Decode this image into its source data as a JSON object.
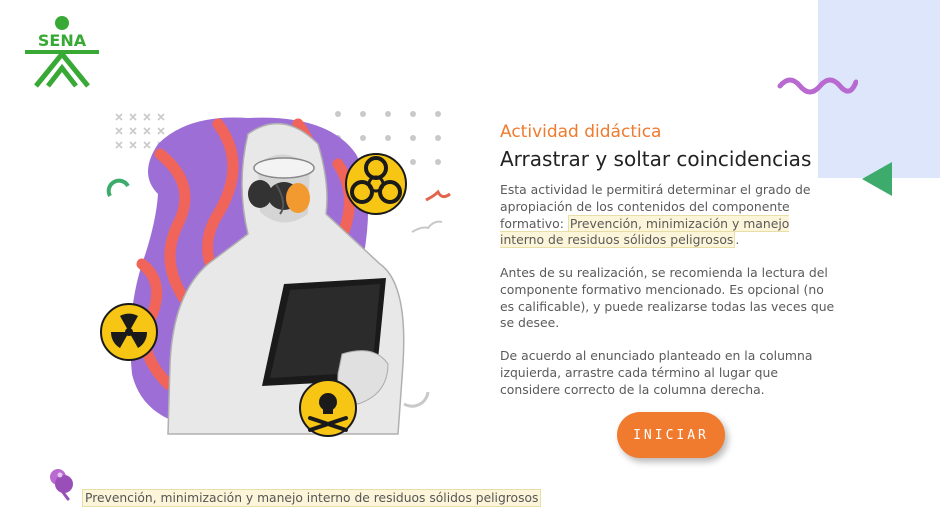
{
  "logo": {
    "text": "SENA",
    "color": "#39a935"
  },
  "main": {
    "subtitle": "Actividad didáctica",
    "title": "Arrastrar y soltar coincidencias",
    "paragraph1_intro": "Esta actividad le permitirá determinar el grado de apropiación de los contenidos del componente formativo:",
    "component_name": "Prevención, minimización y manejo interno de residuos sólidos peligrosos",
    "paragraph1_end": ".",
    "paragraph2": "Antes de su realización, se recomienda la lectura del componente formativo mencionado.  Es opcional (no es calificable), y puede realizarse todas las veces que se desee.",
    "paragraph3": "De acuerdo al enunciado planteado en la columna izquierda, arrastre cada término al lugar que considere correcto de la columna derecha.",
    "start_button": "INICIAR"
  },
  "footer": {
    "component_label": "Prevención, minimización y manejo interno de residuos sólidos peligrosos"
  },
  "icons": {
    "hazard_symbols": [
      "biohazard-icon",
      "radiation-icon",
      "toxic-skull-icon"
    ],
    "footer": "pin-icon"
  },
  "colors": {
    "accent_orange": "#f07a2d",
    "sena_green": "#39a935",
    "deco_blue": "#dde6fb",
    "deco_purple": "#b86ad0",
    "deco_green": "#3cab6c",
    "hazard_yellow": "#f7c514"
  }
}
